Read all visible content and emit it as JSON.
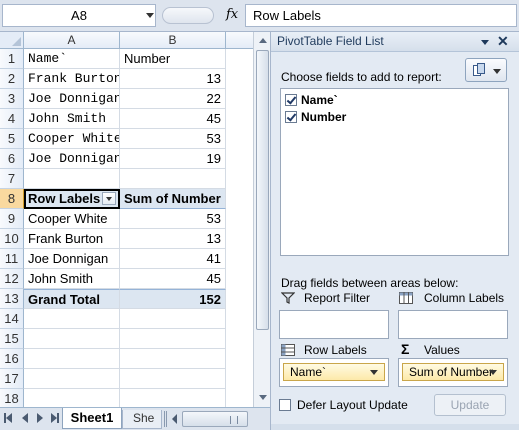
{
  "formula_bar": {
    "name_box": "A8",
    "fx_label": "fx",
    "content": "Row Labels"
  },
  "grid": {
    "columns": [
      "A",
      "B"
    ],
    "rows": [
      "1",
      "2",
      "3",
      "4",
      "5",
      "6",
      "7",
      "8",
      "9",
      "10",
      "11",
      "12",
      "13",
      "14",
      "15",
      "16",
      "17",
      "18"
    ],
    "source_header": {
      "name": "Name`",
      "number": "Number"
    },
    "source_data": [
      {
        "name": "Frank Burton",
        "number": "13"
      },
      {
        "name": "Joe Donnigan",
        "number": "22"
      },
      {
        "name": "John Smith",
        "number": "45"
      },
      {
        "name": "Cooper White",
        "number": "53"
      },
      {
        "name": "Joe Donnigan",
        "number": "19"
      }
    ],
    "pivot_header": {
      "row_labels": "Row Labels",
      "sum": "Sum of Number"
    },
    "pivot_rows": [
      {
        "label": "Cooper White",
        "value": "53"
      },
      {
        "label": "Frank Burton",
        "value": "13"
      },
      {
        "label": "Joe Donnigan",
        "value": "41"
      },
      {
        "label": "John Smith",
        "value": "45"
      }
    ],
    "grand_total": {
      "label": "Grand Total",
      "value": "152"
    }
  },
  "sheet_tabs": {
    "active": "Sheet1",
    "other": "She"
  },
  "pivot_pane": {
    "title": "PivotTable Field List",
    "close_glyph": "✕",
    "choose_label": "Choose fields to add to report:",
    "fields": [
      {
        "label": "Name`",
        "checked": true
      },
      {
        "label": "Number",
        "checked": true
      }
    ],
    "drag_label": "Drag fields between areas below:",
    "areas": {
      "report_filter": "Report Filter",
      "column_labels": "Column Labels",
      "row_labels": "Row Labels",
      "values": "Values",
      "values_symbol": "Σ"
    },
    "row_labels_chip": "Name`",
    "values_chip": "Sum of Number",
    "defer_label": "Defer Layout Update",
    "update_label": "Update"
  },
  "colors": {
    "selection": "#f9d99f",
    "pivot_header_fill": "#dce6f1",
    "chip_fill": "#fde9a9",
    "pane_bg": "#e3eaf3"
  }
}
